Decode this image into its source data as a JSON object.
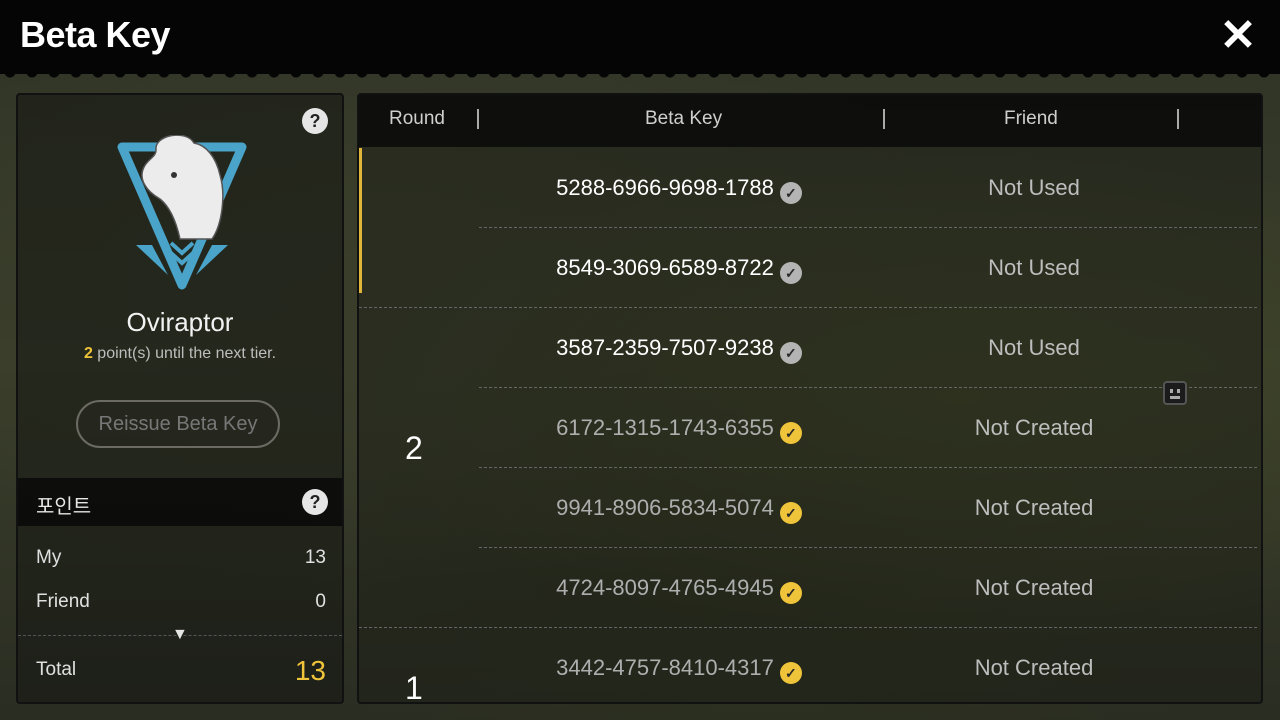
{
  "header": {
    "title": "Beta Key",
    "close_icon": "close-icon"
  },
  "profile": {
    "species": "Oviraptor",
    "points_to_next_tier": "2",
    "tier_text": " point(s) until the next tier.",
    "reissue_label": "Reissue Beta Key"
  },
  "points": {
    "heading": "포인트",
    "my_label": "My",
    "my_value": "13",
    "friend_label": "Friend",
    "friend_value": "0",
    "total_label": "Total",
    "total_value": "13"
  },
  "table": {
    "columns": [
      "Round",
      "Beta Key",
      "Friend"
    ],
    "rows": [
      {
        "key": "5288-6966-9698-1788",
        "status": "Not Used",
        "check": "grey"
      },
      {
        "key": "8549-3069-6589-8722",
        "status": "Not Used",
        "check": "grey"
      },
      {
        "key": "3587-2359-7507-9238",
        "status": "Not Used",
        "check": "grey"
      },
      {
        "key": "6172-1315-1743-6355",
        "status": "Not Created",
        "check": "gold"
      },
      {
        "key": "9941-8906-5834-5074",
        "status": "Not Created",
        "check": "gold"
      },
      {
        "key": "4724-8097-4765-4945",
        "status": "Not Created",
        "check": "gold"
      },
      {
        "key": "3442-4757-8410-4317",
        "status": "Not Created",
        "check": "gold"
      }
    ],
    "round_labels": [
      "2",
      "1"
    ]
  },
  "colors": {
    "accent_gold": "#f0c43a",
    "emblem_blue": "#4aa3c8"
  }
}
